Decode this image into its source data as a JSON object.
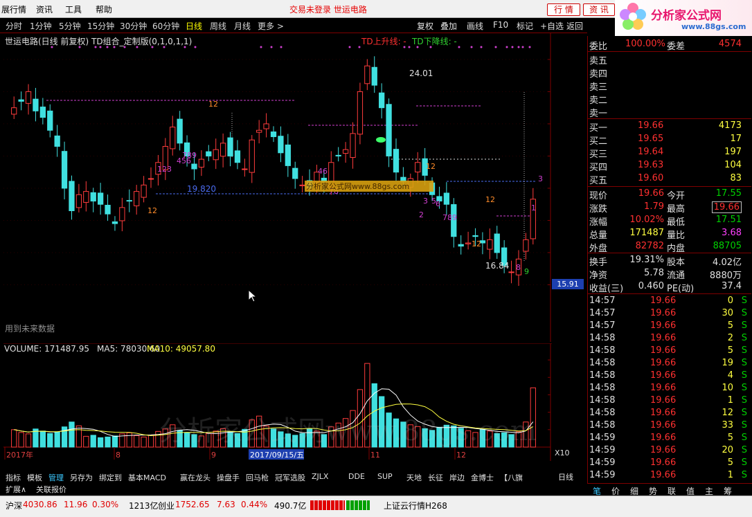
{
  "menu": {
    "items": [
      "展行情",
      "资讯",
      "工具",
      "帮助"
    ],
    "status_title": "交易未登录    世运电路",
    "btn_quote": "行 情",
    "btn_info": "资 讯",
    "logo_text": "分析家公式网",
    "logo_url": "www.88gs.com",
    "logo_subtext": "fenxijia.com"
  },
  "periods": [
    "分时",
    "1分钟",
    "5分钟",
    "15分钟",
    "30分钟",
    "60分钟",
    "日线",
    "周线",
    "月线",
    "更多 >"
  ],
  "active_period": "日线",
  "tool_buttons": [
    "复权",
    "叠加",
    "画线",
    "F10",
    "标记",
    "+自选",
    "返回"
  ],
  "chart": {
    "info": "世运电路(日线 前复权) TD组合_定制版(0,1,0,1,1)",
    "td_up": "TD上升线: -",
    "td_down": "TD下降线: -",
    "future_note": "用到未来数据",
    "price_high_label": "24.01",
    "price_low_label": "16.84",
    "support_label": "19.820",
    "last_price_tag": "15.91",
    "watermark_small": "分析家公式网www.88gs.com",
    "watermark_big": "分析家公式网www.88gs.com",
    "td_counts": [
      {
        "t": "12",
        "c": "orange"
      },
      {
        "t": "12",
        "c": "orange"
      },
      {
        "t": "123",
        "c": "magenta"
      },
      {
        "t": "456",
        "c": "magenta"
      },
      {
        "t": "789",
        "c": "magenta"
      },
      {
        "t": "78",
        "c": "magenta"
      },
      {
        "t": "46",
        "c": "magenta"
      },
      {
        "t": "12",
        "c": "orange"
      },
      {
        "t": "12",
        "c": "orange"
      },
      {
        "t": "12",
        "c": "orange"
      },
      {
        "t": "789",
        "c": "magenta"
      },
      {
        "t": "2",
        "c": "magenta"
      },
      {
        "t": "3",
        "c": "magenta"
      },
      {
        "t": "5",
        "c": "magenta"
      },
      {
        "t": "6",
        "c": "magenta"
      },
      {
        "t": "8",
        "c": "magenta"
      },
      {
        "t": "9",
        "c": "green"
      },
      {
        "t": "1",
        "c": "magenta"
      },
      {
        "t": "3",
        "c": "magenta"
      }
    ]
  },
  "chart_data": [
    {
      "type": "line",
      "title": "世运电路(日线 前复权)",
      "note": "Candlestick price chart (daily, forward-adjusted)",
      "y_ticks": [
        "24.00",
        "23.00",
        "22.00",
        "21.00",
        "20.00",
        "19.00",
        "18.00",
        "17.00"
      ],
      "ylim": [
        16.0,
        24.6
      ],
      "series": [
        {
          "name": "close",
          "values": [
            22.5,
            22.7,
            23.0,
            22.4,
            22.2,
            21.8,
            21.3,
            20.0,
            19.3,
            19.8,
            19.9,
            19.6,
            19.5,
            19.2,
            18.9,
            19.4,
            19.6,
            19.9,
            20.1,
            20.3,
            20.8,
            21.3,
            21.9,
            21.4,
            21.0,
            20.6,
            20.9,
            21.0,
            21.2,
            21.4,
            21.0,
            20.8,
            20.6,
            21.5,
            21.8,
            22.0,
            21.6,
            21.1,
            20.7,
            20.3,
            20.1,
            20.0,
            20.5,
            20.2,
            20.8,
            21.0,
            21.2,
            21.7,
            23.0,
            23.8,
            23.2,
            22.5,
            21.0,
            20.5,
            20.2,
            20.3,
            20.8,
            20.4,
            19.8,
            19.6,
            19.5,
            18.5,
            18.2,
            18.3,
            18.5,
            18.3,
            18.4,
            18.0,
            17.6,
            17.4,
            17.8,
            18.4,
            19.66
          ]
        }
      ]
    },
    {
      "type": "bar",
      "title": "VOLUME",
      "y_ticks": [
        "25000",
        "20000",
        "15000",
        "10000",
        "5000"
      ],
      "ylim": [
        0,
        27000
      ],
      "x_labels": [
        "2017年",
        "8",
        "9",
        "2017/09/15/五",
        "11",
        "12"
      ],
      "values": [
        5000,
        4200,
        3800,
        5200,
        4600,
        3900,
        4300,
        5800,
        7200,
        6100,
        3100,
        3400,
        2700,
        2900,
        3200,
        3800,
        4100,
        3300,
        2900,
        3400,
        4500,
        5200,
        6400,
        4800,
        4100,
        3600,
        3200,
        3900,
        4600,
        5300,
        4400,
        3900,
        5100,
        7800,
        8900,
        6100,
        5200,
        4400,
        3800,
        3400,
        3900,
        5200,
        4600,
        3600,
        5800,
        6900,
        8200,
        10500,
        16500,
        24000,
        18200,
        14500,
        9800,
        8100,
        7200,
        6400,
        5900,
        5300,
        4800,
        5700,
        6300,
        6100,
        5400,
        4700,
        4200,
        5100,
        4600,
        3900,
        4100,
        3600,
        4400,
        7200,
        17000
      ],
      "series": [
        {
          "name": "MA5",
          "last": 78030.6
        },
        {
          "name": "MA10",
          "last": 49057.8
        }
      ]
    }
  ],
  "volume_info": {
    "label": "VOLUME: 171487.95",
    "ma5": "MA5: 78030.60",
    "ma10": "MA10: 49057.80",
    "x10": "X10"
  },
  "quote": {
    "weibi": [
      "委比",
      "100.00%",
      "委差",
      "4574"
    ],
    "sells": [
      "卖五",
      "卖四",
      "卖三",
      "卖二",
      "卖一"
    ],
    "buys": [
      [
        "买一",
        "19.66",
        "4173"
      ],
      [
        "买二",
        "19.65",
        "17"
      ],
      [
        "买三",
        "19.64",
        "197"
      ],
      [
        "买四",
        "19.63",
        "104"
      ],
      [
        "买五",
        "19.60",
        "83"
      ]
    ],
    "stats": [
      [
        "现价",
        "19.66",
        "今开",
        "17.55"
      ],
      [
        "涨跌",
        "1.79",
        "最高",
        "19.66"
      ],
      [
        "涨幅",
        "10.02%",
        "最低",
        "17.51"
      ],
      [
        "总量",
        "171487",
        "量比",
        "3.68"
      ],
      [
        "外盘",
        "82782",
        "内盘",
        "88705"
      ]
    ],
    "stats2": [
      [
        "换手",
        "19.31%",
        "股本",
        "4.02亿"
      ],
      [
        "净资",
        "5.78",
        "流通",
        "8880万"
      ],
      [
        "收益(三)",
        "0.460",
        "PE(动)",
        "37.4"
      ]
    ],
    "ticks": [
      [
        "14:57",
        "19.66",
        "0",
        "S"
      ],
      [
        "14:57",
        "19.66",
        "30",
        "S"
      ],
      [
        "14:57",
        "19.66",
        "5",
        "S"
      ],
      [
        "14:58",
        "19.66",
        "2",
        "S"
      ],
      [
        "14:58",
        "19.66",
        "5",
        "S"
      ],
      [
        "14:58",
        "19.66",
        "19",
        "S"
      ],
      [
        "14:58",
        "19.66",
        "4",
        "S"
      ],
      [
        "14:58",
        "19.66",
        "10",
        "S"
      ],
      [
        "14:58",
        "19.66",
        "1",
        "S"
      ],
      [
        "14:58",
        "19.66",
        "12",
        "S"
      ],
      [
        "14:58",
        "19.66",
        "33",
        "S"
      ],
      [
        "14:59",
        "19.66",
        "5",
        "S"
      ],
      [
        "14:59",
        "19.66",
        "20",
        "S"
      ],
      [
        "14:59",
        "19.66",
        "5",
        "S"
      ],
      [
        "14:59",
        "19.66",
        "1",
        "S"
      ]
    ]
  },
  "bottom_tabs": [
    "指标",
    "模板",
    "管理",
    "另存为",
    "绑定到",
    "基本MACD",
    "赢在龙头",
    "操盘手",
    "回马枪",
    "冠军选股",
    "ZJLX",
    "DDE",
    "SUP",
    "天地",
    "长征",
    "岸边",
    "金博士",
    "【八旗兵】"
  ],
  "active_tab": "管理",
  "bottom_tabs2": [
    "扩展∧",
    "关联报价"
  ],
  "period_label": "日线",
  "right_tabs": [
    "笔",
    "价",
    "细",
    "势",
    "联",
    "值",
    "主",
    "筹"
  ],
  "status": {
    "sh_label": "沪深",
    "sh_index": "4030.86",
    "sh_change": "11.96",
    "sh_pct": "0.30%",
    "sh_amount": "1213亿",
    "cy_label": "创业",
    "cy_index": "1752.65",
    "cy_change": "7.63",
    "cy_pct": "0.44%",
    "cy_amount": "490.7亿",
    "feed": "上证云行情H268"
  }
}
